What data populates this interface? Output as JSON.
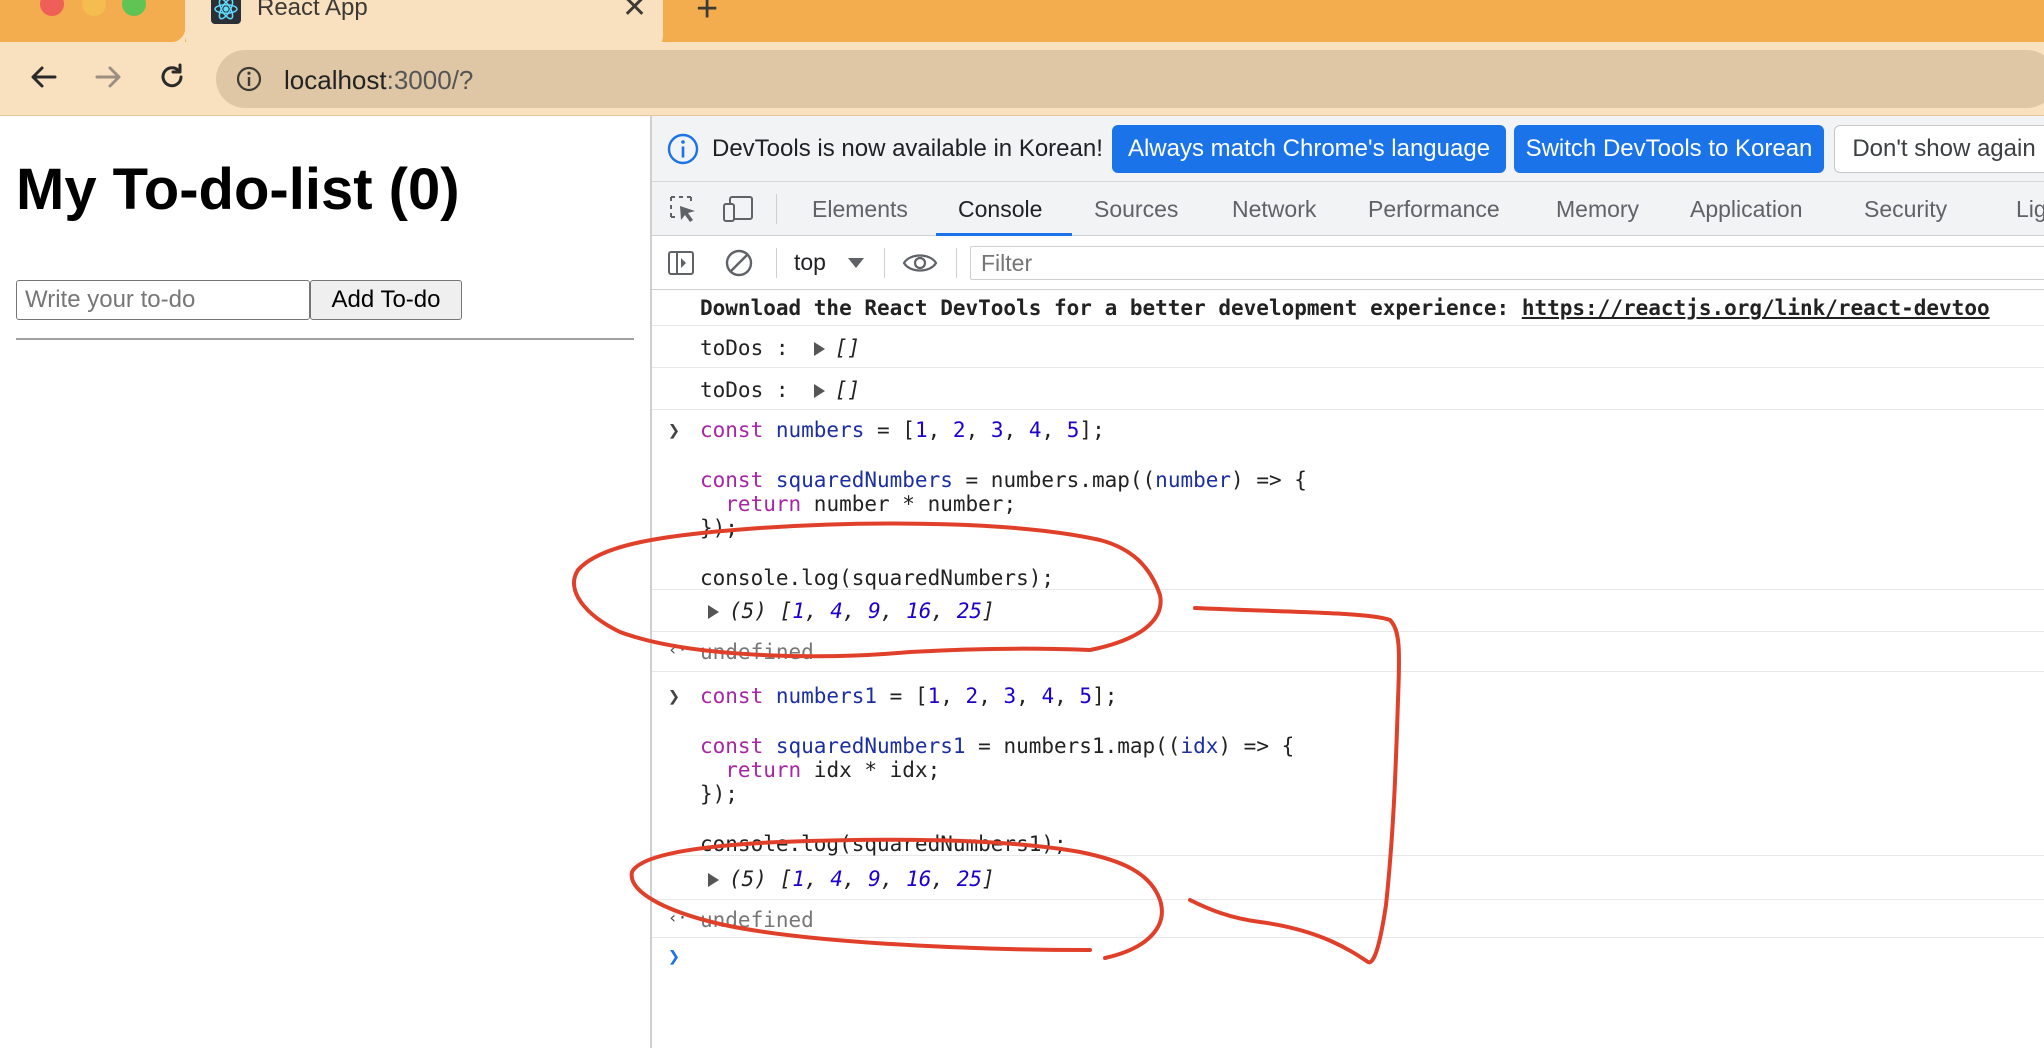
{
  "browser": {
    "tab_title": "React App",
    "url_host": "localhost",
    "url_rest": ":3000/?",
    "colors": {
      "tabstrip": "#f3ad4f",
      "toolbar": "#f9e0bf"
    }
  },
  "page": {
    "title": "My To-do-list (0)",
    "input_placeholder": "Write your to-do",
    "add_button": "Add To-do"
  },
  "devtools": {
    "infobar": {
      "message": "DevTools is now available in Korean!",
      "match_button": "Always match Chrome's language",
      "switch_button": "Switch DevTools to Korean",
      "dismiss_button": "Don't show again"
    },
    "tabs": [
      "Elements",
      "Console",
      "Sources",
      "Network",
      "Performance",
      "Memory",
      "Application",
      "Security",
      "Lig"
    ],
    "active_tab": "Console",
    "context": "top",
    "filter_placeholder": "Filter",
    "console": {
      "react_msg": "Download the React DevTools for a better development experience: ",
      "react_link": "https://reactjs.org/link/react-devtoo",
      "todos_label": "toDos :",
      "empty_array": "[]",
      "input1": {
        "l1": [
          "const",
          " numbers",
          " = [",
          "1",
          ", ",
          "2",
          ", ",
          "3",
          ", ",
          "4",
          ", ",
          "5",
          "];"
        ],
        "l2": [
          "const",
          " squaredNumbers",
          " = numbers.map((",
          "number",
          ") => {"
        ],
        "l3": [
          "  return",
          " number * number;"
        ],
        "l4": "});",
        "l5": "console.log(squaredNumbers);"
      },
      "output1": {
        "count": "(5)",
        "values": [
          "1",
          "4",
          "9",
          "16",
          "25"
        ]
      },
      "undefined": "undefined",
      "input2": {
        "l1": [
          "const",
          " numbers1",
          " = [",
          "1",
          ", ",
          "2",
          ", ",
          "3",
          ", ",
          "4",
          ", ",
          "5",
          "];"
        ],
        "l2": [
          "const",
          " squaredNumbers1",
          " = numbers1.map((",
          "idx",
          ") => {"
        ],
        "l3": [
          "  return",
          " idx * idx;"
        ],
        "l4": "});",
        "l5": "console.log(squaredNumbers1);"
      },
      "output2": {
        "count": "(5)",
        "values": [
          "1",
          "4",
          "9",
          "16",
          "25"
        ]
      }
    }
  },
  "annotation_color": "#e0402a"
}
